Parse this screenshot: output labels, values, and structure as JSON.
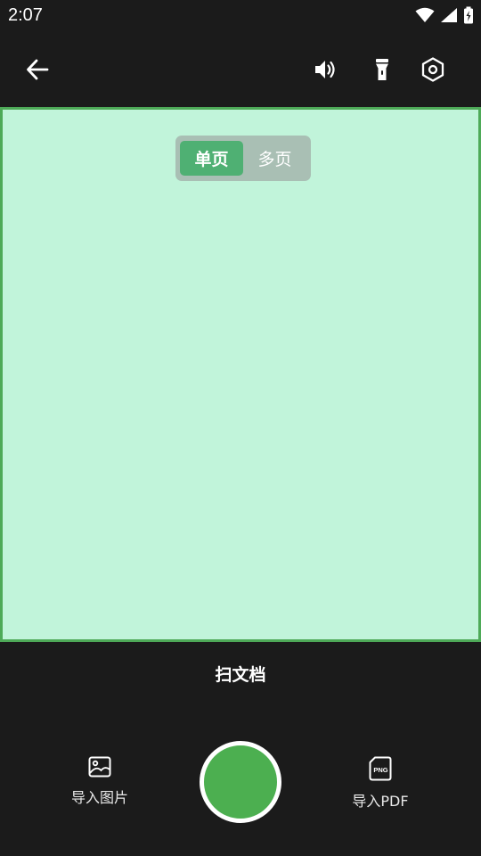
{
  "status_bar": {
    "time": "2:07",
    "icons": [
      "wifi-icon",
      "signal-icon",
      "battery-charging-icon"
    ]
  },
  "toolbar": {
    "back_icon": "arrow-left-icon",
    "sound_icon": "volume-icon",
    "flash_icon": "flashlight-icon",
    "settings_icon": "hexagon-settings-icon"
  },
  "page_mode": {
    "options": [
      {
        "label": "单页",
        "selected": true
      },
      {
        "label": "多页",
        "selected": false
      }
    ]
  },
  "mode_title": "扫文档",
  "bottom_actions": {
    "import_image_label": "导入图片",
    "import_image_icon": "image-icon",
    "import_pdf_label": "导入PDF",
    "import_pdf_icon": "png-file-icon"
  },
  "colors": {
    "background": "#1b1b1b",
    "viewfinder": "#c1f4da",
    "viewfinder_border": "#4eaa58",
    "accent": "#4caf50",
    "segment_active": "#4fb073",
    "segment_track": "#a9bfb4"
  }
}
